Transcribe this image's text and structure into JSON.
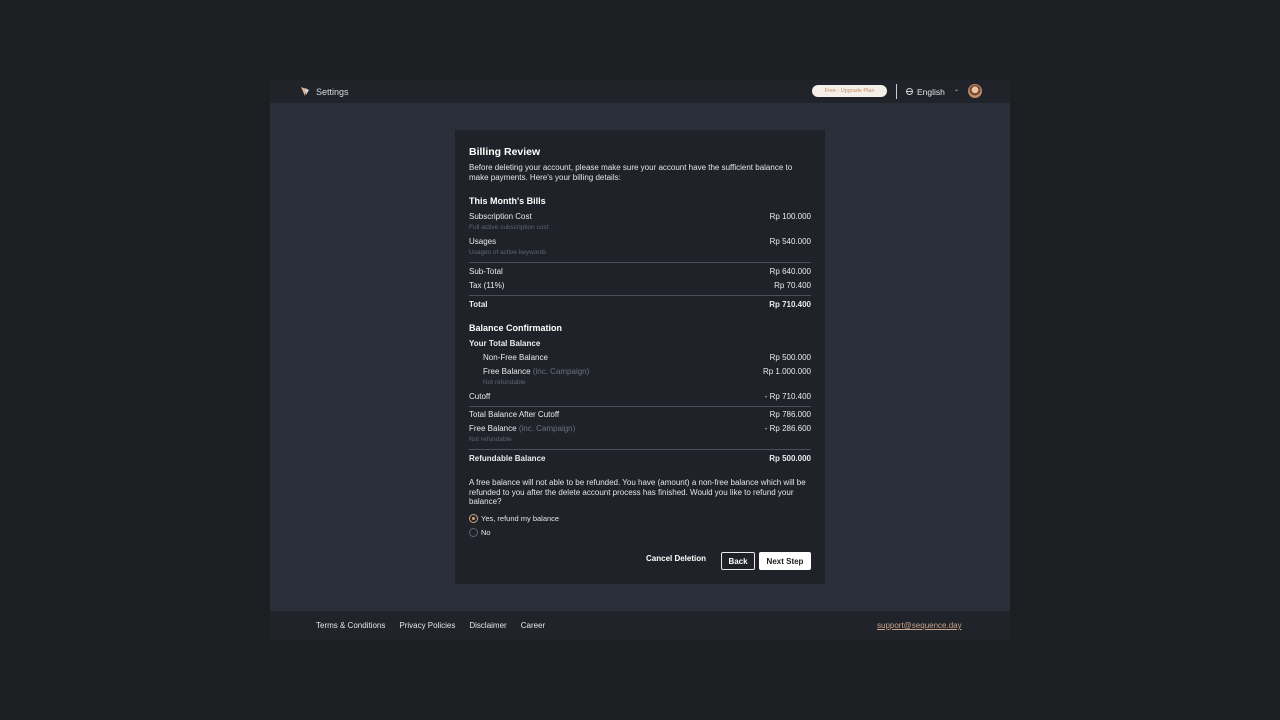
{
  "header": {
    "title": "Settings",
    "plan_badge": "Free - Upgrade Plan",
    "language": "English"
  },
  "billing": {
    "title": "Billing Review",
    "intro": "Before deleting your account, please make sure your account have the sufficient balance to make payments. Here's your billing details:",
    "month_title": "This Month's Bills",
    "subscription_label": "Subscription Cost",
    "subscription_value": "Rp 100.000",
    "subscription_note": "Full active subscription cost",
    "usages_label": "Usages",
    "usages_value": "Rp 540.000",
    "usages_note": "Usages of active keywords",
    "subtotal_label": "Sub-Total",
    "subtotal_value": "Rp 640.000",
    "tax_label": "Tax (11%)",
    "tax_value": "Rp 70.400",
    "total_label": "Total",
    "total_value": "Rp 710.400"
  },
  "balance": {
    "title": "Balance Confirmation",
    "your_total": "Your Total Balance",
    "nonfree_label": "Non-Free Balance",
    "nonfree_value": "Rp 500.000",
    "free_label": "Free Balance",
    "free_inc": "(inc. Campaign)",
    "free_value": "Rp 1.000.000",
    "free_note": "Not refundable",
    "cutoff_label": "Cutoff",
    "cutoff_value": "- Rp 710.400",
    "after_label": "Total Balance After Cutoff",
    "after_value": "Rp 786.000",
    "free2_label": "Free Balance",
    "free2_inc": "(inc. Campaign)",
    "free2_value": "- Rp 286.600",
    "free2_note": "Not refundable",
    "refundable_label": "Refundable Balance",
    "refundable_value": "Rp 500.000"
  },
  "refund": {
    "note": "A free balance will not able to be refunded. You have (amount) a non-free balance which will be refunded to you after the delete account process has finished. Would you like to refund your balance?",
    "option_yes": "Yes, refund my balance",
    "option_no": "No"
  },
  "actions": {
    "cancel": "Cancel Deletion",
    "back": "Back",
    "next": "Next Step"
  },
  "footer": {
    "links": [
      "Terms & Conditions",
      "Privacy Policies",
      "Disclaimer",
      "Career"
    ],
    "email": "support@sequence.day"
  },
  "colors": {
    "accent": "#d6a37c",
    "card": "#1f2329",
    "app_bg": "#2a2f3a"
  }
}
